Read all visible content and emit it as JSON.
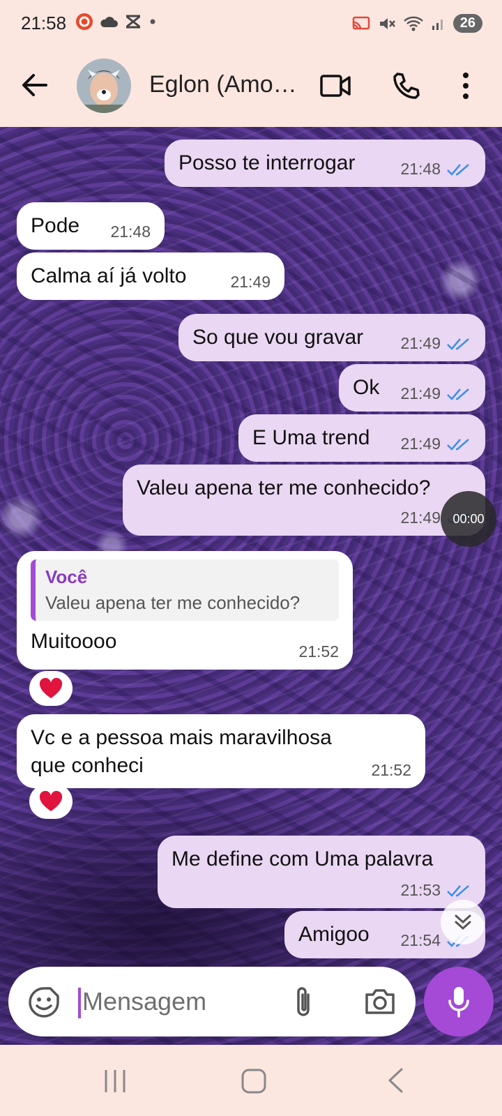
{
  "status_bar": {
    "time": "21:58",
    "battery": "26"
  },
  "header": {
    "contact_name": "Eglon (Amo…"
  },
  "messages": [
    {
      "dir": "out",
      "text": "Posso te interrogar",
      "time": "21:48",
      "read": true
    },
    {
      "dir": "in",
      "text": "Pode",
      "time": "21:48"
    },
    {
      "dir": "in",
      "text": "Calma aí já volto",
      "time": "21:49"
    },
    {
      "dir": "out",
      "text": "So que vou gravar",
      "time": "21:49",
      "read": true
    },
    {
      "dir": "out",
      "text": "Ok",
      "time": "21:49",
      "read": true
    },
    {
      "dir": "out",
      "text": "E Uma trend",
      "time": "21:49",
      "read": true
    },
    {
      "dir": "out",
      "text": "Valeu apena ter me conhecido?",
      "time": "21:49",
      "read": true
    },
    {
      "dir": "in",
      "reply_author": "Você",
      "reply_text": "Valeu apena ter me conhecido?",
      "text": "Muitoooo",
      "time": "21:52",
      "reaction": "heart"
    },
    {
      "dir": "in",
      "text": "Vc e a pessoa mais maravilhosa",
      "text2": "que conheci",
      "time": "21:52",
      "reaction": "heart"
    },
    {
      "dir": "out",
      "text": "Me define com Uma palavra",
      "time": "21:53",
      "read": true
    },
    {
      "dir": "out",
      "text": "Amigoo",
      "time": "21:54",
      "read": true
    }
  ],
  "overlay": {
    "timer": "00:00"
  },
  "composer": {
    "placeholder": "Mensagem"
  },
  "colors": {
    "accent": "#a44ad6",
    "outgoing_bubble": "#ead7f3",
    "incoming_bubble": "#ffffff",
    "read_ticks": "#3d8fe6",
    "app_bar": "#fce6e0"
  },
  "icons": {
    "header": [
      "back-arrow-icon",
      "video-call-icon",
      "phone-icon",
      "more-vert-icon"
    ],
    "composer": [
      "sticker-icon",
      "paperclip-icon",
      "camera-icon",
      "mic-icon"
    ],
    "nav": [
      "recent-apps-icon",
      "home-icon",
      "back-icon"
    ]
  }
}
